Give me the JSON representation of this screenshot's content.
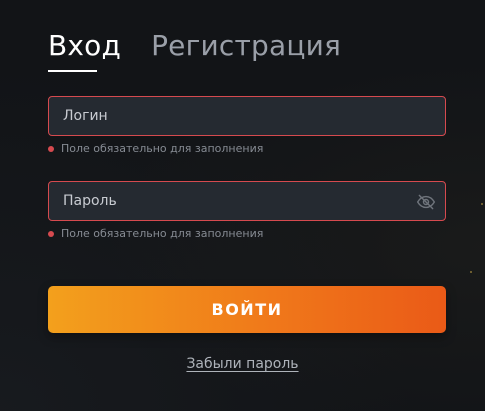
{
  "tabs": {
    "login": "Вход",
    "register": "Регистрация"
  },
  "login_field": {
    "placeholder": "Логин",
    "value": ""
  },
  "password_field": {
    "placeholder": "Пароль",
    "value": "",
    "toggle_icon": "eye-slash-icon"
  },
  "validation": {
    "login_hint": "Поле обязательно для заполнения",
    "password_hint": "Поле обязательно для заполнения"
  },
  "submit_label": "ВОЙТИ",
  "forgot_link": "Забыли пароль",
  "colors": {
    "background": "#121417",
    "field_bg": "#252a31",
    "error": "#d64a4f",
    "button_start": "#f3a01c",
    "button_end": "#ea5a17"
  }
}
